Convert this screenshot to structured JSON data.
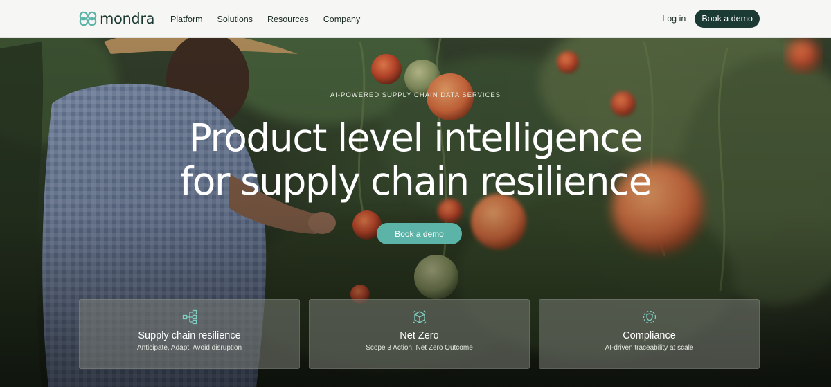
{
  "brand": {
    "name": "mondra",
    "color": "#1d3a33",
    "accent": "#5bb4a7"
  },
  "nav": {
    "links": [
      "Platform",
      "Solutions",
      "Resources",
      "Company"
    ],
    "login": "Log in",
    "cta": "Book a demo"
  },
  "hero": {
    "eyebrow": "AI-POWERED SUPPLY CHAIN DATA SERVICES",
    "headline_line1": "Product level intelligence",
    "headline_line2": "for supply chain resilience",
    "cta": "Book a demo"
  },
  "cards": [
    {
      "icon": "network-hierarchy-icon",
      "title": "Supply chain resilience",
      "subtitle": "Anticipate, Adapt. Avoid disruption"
    },
    {
      "icon": "cube-recycle-icon",
      "title": "Net Zero",
      "subtitle": "Scope 3 Action, Net Zero Outcome"
    },
    {
      "icon": "shield-check-icon",
      "title": "Compliance",
      "subtitle": "AI-driven traceability at scale"
    }
  ]
}
